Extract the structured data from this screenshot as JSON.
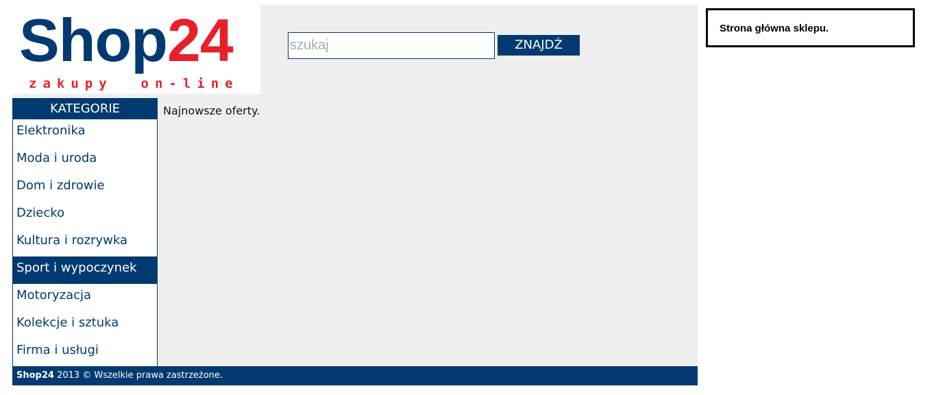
{
  "brand": {
    "name_part1": "Shop",
    "name_part2": "24",
    "tagline": "zakupy  on-line",
    "primary_color": "#003a70",
    "accent_color": "#e8202a"
  },
  "search": {
    "placeholder": "szukaj",
    "value": "",
    "button_label": "ZNAJDŹ"
  },
  "categories": {
    "title": "KATEGORIE",
    "active_index": 5,
    "items": [
      {
        "label": "Elektronika"
      },
      {
        "label": "Moda i uroda"
      },
      {
        "label": "Dom i zdrowie"
      },
      {
        "label": "Dziecko"
      },
      {
        "label": "Kultura i rozrywka"
      },
      {
        "label": "Sport i wypoczynek"
      },
      {
        "label": "Motoryzacja"
      },
      {
        "label": "Kolekcje i sztuka"
      },
      {
        "label": "Firma i usługi"
      }
    ]
  },
  "content": {
    "text": "Najnowsze oferty."
  },
  "footer": {
    "brand": "Shop24",
    "text": " 2013 © Wszelkie prawa zastrzeżone."
  },
  "info_box": {
    "text": "Strona główna sklepu."
  }
}
